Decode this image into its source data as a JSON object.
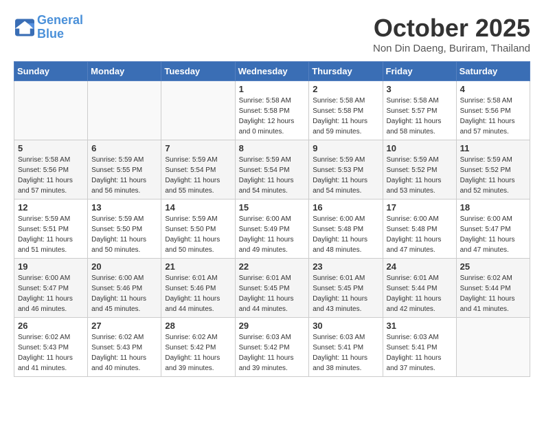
{
  "logo": {
    "line1": "General",
    "line2": "Blue"
  },
  "title": "October 2025",
  "subtitle": "Non Din Daeng, Buriram, Thailand",
  "weekdays": [
    "Sunday",
    "Monday",
    "Tuesday",
    "Wednesday",
    "Thursday",
    "Friday",
    "Saturday"
  ],
  "weeks": [
    [
      {
        "day": "",
        "info": ""
      },
      {
        "day": "",
        "info": ""
      },
      {
        "day": "",
        "info": ""
      },
      {
        "day": "1",
        "info": "Sunrise: 5:58 AM\nSunset: 5:58 PM\nDaylight: 12 hours\nand 0 minutes."
      },
      {
        "day": "2",
        "info": "Sunrise: 5:58 AM\nSunset: 5:58 PM\nDaylight: 11 hours\nand 59 minutes."
      },
      {
        "day": "3",
        "info": "Sunrise: 5:58 AM\nSunset: 5:57 PM\nDaylight: 11 hours\nand 58 minutes."
      },
      {
        "day": "4",
        "info": "Sunrise: 5:58 AM\nSunset: 5:56 PM\nDaylight: 11 hours\nand 57 minutes."
      }
    ],
    [
      {
        "day": "5",
        "info": "Sunrise: 5:58 AM\nSunset: 5:56 PM\nDaylight: 11 hours\nand 57 minutes."
      },
      {
        "day": "6",
        "info": "Sunrise: 5:59 AM\nSunset: 5:55 PM\nDaylight: 11 hours\nand 56 minutes."
      },
      {
        "day": "7",
        "info": "Sunrise: 5:59 AM\nSunset: 5:54 PM\nDaylight: 11 hours\nand 55 minutes."
      },
      {
        "day": "8",
        "info": "Sunrise: 5:59 AM\nSunset: 5:54 PM\nDaylight: 11 hours\nand 54 minutes."
      },
      {
        "day": "9",
        "info": "Sunrise: 5:59 AM\nSunset: 5:53 PM\nDaylight: 11 hours\nand 54 minutes."
      },
      {
        "day": "10",
        "info": "Sunrise: 5:59 AM\nSunset: 5:52 PM\nDaylight: 11 hours\nand 53 minutes."
      },
      {
        "day": "11",
        "info": "Sunrise: 5:59 AM\nSunset: 5:52 PM\nDaylight: 11 hours\nand 52 minutes."
      }
    ],
    [
      {
        "day": "12",
        "info": "Sunrise: 5:59 AM\nSunset: 5:51 PM\nDaylight: 11 hours\nand 51 minutes."
      },
      {
        "day": "13",
        "info": "Sunrise: 5:59 AM\nSunset: 5:50 PM\nDaylight: 11 hours\nand 50 minutes."
      },
      {
        "day": "14",
        "info": "Sunrise: 5:59 AM\nSunset: 5:50 PM\nDaylight: 11 hours\nand 50 minutes."
      },
      {
        "day": "15",
        "info": "Sunrise: 6:00 AM\nSunset: 5:49 PM\nDaylight: 11 hours\nand 49 minutes."
      },
      {
        "day": "16",
        "info": "Sunrise: 6:00 AM\nSunset: 5:48 PM\nDaylight: 11 hours\nand 48 minutes."
      },
      {
        "day": "17",
        "info": "Sunrise: 6:00 AM\nSunset: 5:48 PM\nDaylight: 11 hours\nand 47 minutes."
      },
      {
        "day": "18",
        "info": "Sunrise: 6:00 AM\nSunset: 5:47 PM\nDaylight: 11 hours\nand 47 minutes."
      }
    ],
    [
      {
        "day": "19",
        "info": "Sunrise: 6:00 AM\nSunset: 5:47 PM\nDaylight: 11 hours\nand 46 minutes."
      },
      {
        "day": "20",
        "info": "Sunrise: 6:00 AM\nSunset: 5:46 PM\nDaylight: 11 hours\nand 45 minutes."
      },
      {
        "day": "21",
        "info": "Sunrise: 6:01 AM\nSunset: 5:46 PM\nDaylight: 11 hours\nand 44 minutes."
      },
      {
        "day": "22",
        "info": "Sunrise: 6:01 AM\nSunset: 5:45 PM\nDaylight: 11 hours\nand 44 minutes."
      },
      {
        "day": "23",
        "info": "Sunrise: 6:01 AM\nSunset: 5:45 PM\nDaylight: 11 hours\nand 43 minutes."
      },
      {
        "day": "24",
        "info": "Sunrise: 6:01 AM\nSunset: 5:44 PM\nDaylight: 11 hours\nand 42 minutes."
      },
      {
        "day": "25",
        "info": "Sunrise: 6:02 AM\nSunset: 5:44 PM\nDaylight: 11 hours\nand 41 minutes."
      }
    ],
    [
      {
        "day": "26",
        "info": "Sunrise: 6:02 AM\nSunset: 5:43 PM\nDaylight: 11 hours\nand 41 minutes."
      },
      {
        "day": "27",
        "info": "Sunrise: 6:02 AM\nSunset: 5:43 PM\nDaylight: 11 hours\nand 40 minutes."
      },
      {
        "day": "28",
        "info": "Sunrise: 6:02 AM\nSunset: 5:42 PM\nDaylight: 11 hours\nand 39 minutes."
      },
      {
        "day": "29",
        "info": "Sunrise: 6:03 AM\nSunset: 5:42 PM\nDaylight: 11 hours\nand 39 minutes."
      },
      {
        "day": "30",
        "info": "Sunrise: 6:03 AM\nSunset: 5:41 PM\nDaylight: 11 hours\nand 38 minutes."
      },
      {
        "day": "31",
        "info": "Sunrise: 6:03 AM\nSunset: 5:41 PM\nDaylight: 11 hours\nand 37 minutes."
      },
      {
        "day": "",
        "info": ""
      }
    ]
  ]
}
